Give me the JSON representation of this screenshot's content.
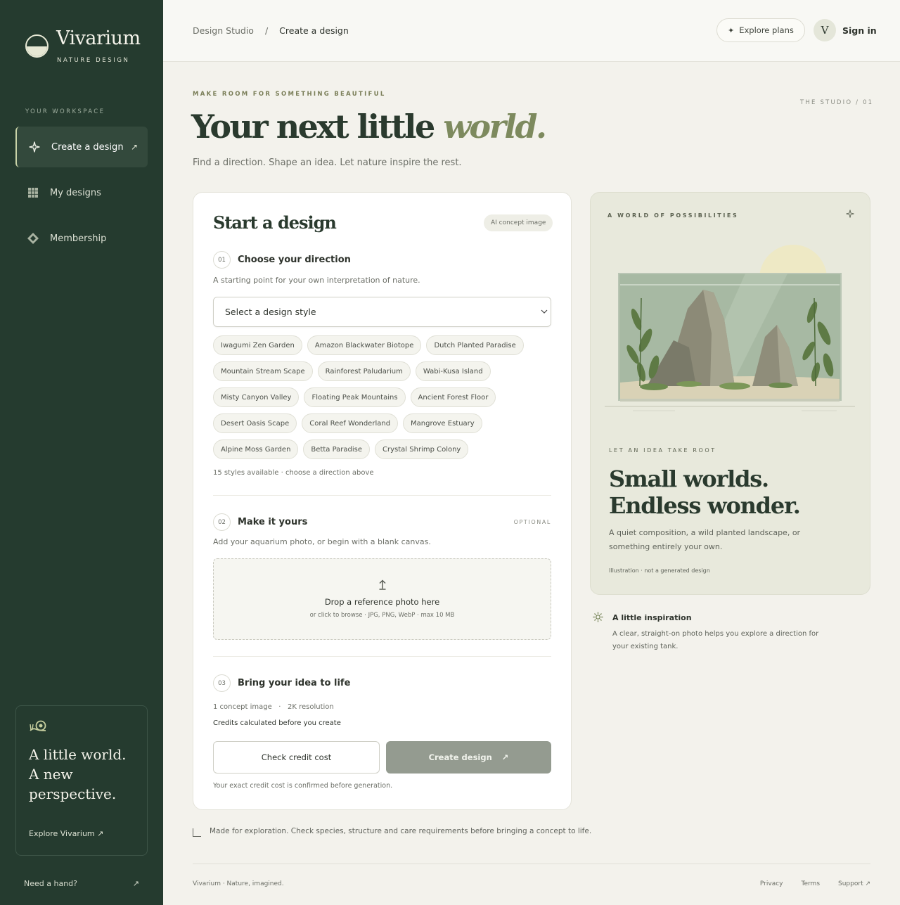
{
  "brand": {
    "name": "Vivarium",
    "sub": "NATURE DESIGN"
  },
  "sidebar": {
    "section_label": "YOUR WORKSPACE",
    "items": [
      {
        "label": "Create a design",
        "icon": "sparkle-icon",
        "active": true
      },
      {
        "label": "My designs",
        "icon": "grid-icon"
      },
      {
        "label": "Membership",
        "icon": "diamond-icon"
      }
    ],
    "promo": {
      "title": "A little world. A new perspective.",
      "link": "Explore Vivarium ↗"
    },
    "help": {
      "label": "Need a hand?",
      "arrow": "↗"
    }
  },
  "topbar": {
    "breadcrumb": {
      "root": "Design Studio",
      "sep": "/",
      "current": "Create a design"
    },
    "plans_label": "Explore plans",
    "avatar_letter": "V",
    "signin_label": "Sign in"
  },
  "header": {
    "eyebrow": "MAKE ROOM FOR SOMETHING BEAUTIFUL",
    "studio_tag": "THE STUDIO / 01",
    "title_main": "Your next little ",
    "title_em": "world.",
    "subtitle": "Find a direction. Shape an idea. Let nature inspire the rest."
  },
  "card": {
    "title": "Start a design",
    "badge": "AI concept image",
    "step1": {
      "num": "01",
      "title": "Choose your direction",
      "desc": "A starting point for your own interpretation of nature.",
      "select_value": "Select a design style",
      "styles": [
        "Iwagumi Zen Garden",
        "Amazon Blackwater Biotope",
        "Dutch Planted Paradise",
        "Mountain Stream Scape",
        "Rainforest Paludarium",
        "Wabi-Kusa Island",
        "Misty Canyon Valley",
        "Floating Peak Mountains",
        "Ancient Forest Floor",
        "Desert Oasis Scape",
        "Coral Reef Wonderland",
        "Mangrove Estuary",
        "Alpine Moss Garden",
        "Betta Paradise",
        "Crystal Shrimp Colony"
      ],
      "note": "15 styles available · choose a direction above"
    },
    "step2": {
      "num": "02",
      "title": "Make it yours",
      "optional": "OPTIONAL",
      "desc": "Add your aquarium photo, or begin with a blank canvas.",
      "drop_title": "Drop a reference photo here",
      "drop_sub": "or click to browse · JPG, PNG, WebP · max 10 MB"
    },
    "step3": {
      "num": "03",
      "title": "Bring your idea to life",
      "meta": "1 concept image   ·   2K resolution",
      "credits_note": "Credits calculated before you create",
      "check_label": "Check credit cost",
      "create_label": "Create design",
      "confirm_note": "Your exact credit cost is confirmed before generation."
    }
  },
  "disclaimer": "Made for exploration. Check species, structure and care requirements before bringing a concept to life.",
  "panel": {
    "eyebrow": "A WORLD OF POSSIBILITIES",
    "eyebrow2": "LET AN IDEA TAKE ROOT",
    "title_line1": "Small worlds.",
    "title_line2": "Endless wonder.",
    "desc": "A quiet composition, a wild planted landscape, or something entirely your own.",
    "note": "Illustration · not a generated design"
  },
  "inspiration": {
    "title": "A little inspiration",
    "desc": "A clear, straight-on photo helps you explore a direction for your existing tank."
  },
  "footer": {
    "left": "Vivarium · Nature, imagined.",
    "links": [
      "Privacy",
      "Terms",
      "Support ↗"
    ]
  }
}
